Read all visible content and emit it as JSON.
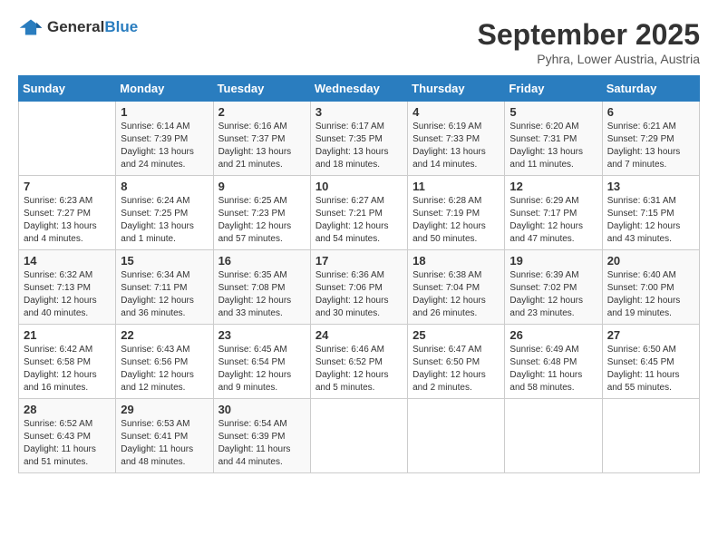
{
  "logo": {
    "general": "General",
    "blue": "Blue"
  },
  "header": {
    "month": "September 2025",
    "location": "Pyhra, Lower Austria, Austria"
  },
  "weekdays": [
    "Sunday",
    "Monday",
    "Tuesday",
    "Wednesday",
    "Thursday",
    "Friday",
    "Saturday"
  ],
  "weeks": [
    [
      {
        "day": "",
        "info": ""
      },
      {
        "day": "1",
        "info": "Sunrise: 6:14 AM\nSunset: 7:39 PM\nDaylight: 13 hours\nand 24 minutes."
      },
      {
        "day": "2",
        "info": "Sunrise: 6:16 AM\nSunset: 7:37 PM\nDaylight: 13 hours\nand 21 minutes."
      },
      {
        "day": "3",
        "info": "Sunrise: 6:17 AM\nSunset: 7:35 PM\nDaylight: 13 hours\nand 18 minutes."
      },
      {
        "day": "4",
        "info": "Sunrise: 6:19 AM\nSunset: 7:33 PM\nDaylight: 13 hours\nand 14 minutes."
      },
      {
        "day": "5",
        "info": "Sunrise: 6:20 AM\nSunset: 7:31 PM\nDaylight: 13 hours\nand 11 minutes."
      },
      {
        "day": "6",
        "info": "Sunrise: 6:21 AM\nSunset: 7:29 PM\nDaylight: 13 hours\nand 7 minutes."
      }
    ],
    [
      {
        "day": "7",
        "info": "Sunrise: 6:23 AM\nSunset: 7:27 PM\nDaylight: 13 hours\nand 4 minutes."
      },
      {
        "day": "8",
        "info": "Sunrise: 6:24 AM\nSunset: 7:25 PM\nDaylight: 13 hours\nand 1 minute."
      },
      {
        "day": "9",
        "info": "Sunrise: 6:25 AM\nSunset: 7:23 PM\nDaylight: 12 hours\nand 57 minutes."
      },
      {
        "day": "10",
        "info": "Sunrise: 6:27 AM\nSunset: 7:21 PM\nDaylight: 12 hours\nand 54 minutes."
      },
      {
        "day": "11",
        "info": "Sunrise: 6:28 AM\nSunset: 7:19 PM\nDaylight: 12 hours\nand 50 minutes."
      },
      {
        "day": "12",
        "info": "Sunrise: 6:29 AM\nSunset: 7:17 PM\nDaylight: 12 hours\nand 47 minutes."
      },
      {
        "day": "13",
        "info": "Sunrise: 6:31 AM\nSunset: 7:15 PM\nDaylight: 12 hours\nand 43 minutes."
      }
    ],
    [
      {
        "day": "14",
        "info": "Sunrise: 6:32 AM\nSunset: 7:13 PM\nDaylight: 12 hours\nand 40 minutes."
      },
      {
        "day": "15",
        "info": "Sunrise: 6:34 AM\nSunset: 7:11 PM\nDaylight: 12 hours\nand 36 minutes."
      },
      {
        "day": "16",
        "info": "Sunrise: 6:35 AM\nSunset: 7:08 PM\nDaylight: 12 hours\nand 33 minutes."
      },
      {
        "day": "17",
        "info": "Sunrise: 6:36 AM\nSunset: 7:06 PM\nDaylight: 12 hours\nand 30 minutes."
      },
      {
        "day": "18",
        "info": "Sunrise: 6:38 AM\nSunset: 7:04 PM\nDaylight: 12 hours\nand 26 minutes."
      },
      {
        "day": "19",
        "info": "Sunrise: 6:39 AM\nSunset: 7:02 PM\nDaylight: 12 hours\nand 23 minutes."
      },
      {
        "day": "20",
        "info": "Sunrise: 6:40 AM\nSunset: 7:00 PM\nDaylight: 12 hours\nand 19 minutes."
      }
    ],
    [
      {
        "day": "21",
        "info": "Sunrise: 6:42 AM\nSunset: 6:58 PM\nDaylight: 12 hours\nand 16 minutes."
      },
      {
        "day": "22",
        "info": "Sunrise: 6:43 AM\nSunset: 6:56 PM\nDaylight: 12 hours\nand 12 minutes."
      },
      {
        "day": "23",
        "info": "Sunrise: 6:45 AM\nSunset: 6:54 PM\nDaylight: 12 hours\nand 9 minutes."
      },
      {
        "day": "24",
        "info": "Sunrise: 6:46 AM\nSunset: 6:52 PM\nDaylight: 12 hours\nand 5 minutes."
      },
      {
        "day": "25",
        "info": "Sunrise: 6:47 AM\nSunset: 6:50 PM\nDaylight: 12 hours\nand 2 minutes."
      },
      {
        "day": "26",
        "info": "Sunrise: 6:49 AM\nSunset: 6:48 PM\nDaylight: 11 hours\nand 58 minutes."
      },
      {
        "day": "27",
        "info": "Sunrise: 6:50 AM\nSunset: 6:45 PM\nDaylight: 11 hours\nand 55 minutes."
      }
    ],
    [
      {
        "day": "28",
        "info": "Sunrise: 6:52 AM\nSunset: 6:43 PM\nDaylight: 11 hours\nand 51 minutes."
      },
      {
        "day": "29",
        "info": "Sunrise: 6:53 AM\nSunset: 6:41 PM\nDaylight: 11 hours\nand 48 minutes."
      },
      {
        "day": "30",
        "info": "Sunrise: 6:54 AM\nSunset: 6:39 PM\nDaylight: 11 hours\nand 44 minutes."
      },
      {
        "day": "",
        "info": ""
      },
      {
        "day": "",
        "info": ""
      },
      {
        "day": "",
        "info": ""
      },
      {
        "day": "",
        "info": ""
      }
    ]
  ]
}
